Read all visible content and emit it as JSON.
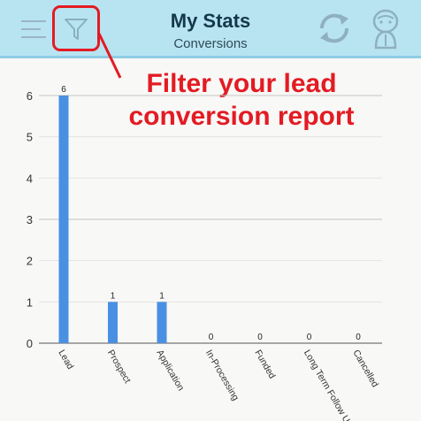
{
  "header": {
    "title": "My Stats",
    "subtitle": "Conversions",
    "icons": [
      "menu-icon",
      "filter-icon",
      "refresh-icon",
      "profile-icon"
    ]
  },
  "callout": {
    "line1": "Filter your lead",
    "line2": "conversion report",
    "color": "#e31b23"
  },
  "colors": {
    "header_bg": "#b8e4f2",
    "bar": "#4a90e2",
    "highlight": "#e31b23"
  },
  "chart_data": {
    "type": "bar",
    "categories": [
      "Lead",
      "Prospect",
      "Application",
      "In-Processing",
      "Funded",
      "Long Term Follow U",
      "Cancelled"
    ],
    "values": [
      6,
      1,
      1,
      0,
      0,
      0,
      0
    ],
    "ylim": [
      0,
      6
    ],
    "yticks": [
      0,
      1,
      2,
      3,
      4,
      5,
      6
    ],
    "grid": true,
    "data_labels": true
  }
}
